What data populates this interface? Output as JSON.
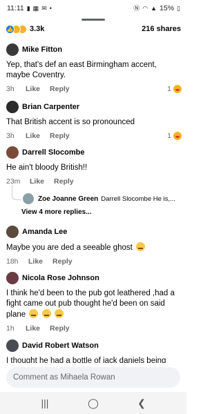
{
  "status_bar": {
    "time": "11:11",
    "battery": "15%"
  },
  "summary": {
    "reaction_count": "3.3k",
    "shares": "216 shares"
  },
  "comments": [
    {
      "name": "Mike Fitton",
      "text": "Yep, that's def an east Birmingham accent, maybe Coventry.",
      "time": "3h",
      "like_label": "Like",
      "reply_label": "Reply",
      "reaction_count": "1",
      "avatar_color": "#3a3a3a"
    },
    {
      "name": "Brian Carpenter",
      "text": "That British accent is so pronounced",
      "time": "3h",
      "like_label": "Like",
      "reply_label": "Reply",
      "reaction_count": "1",
      "avatar_color": "#2b2b2b"
    },
    {
      "name": "Darrell Slocombe",
      "text": "He ain't bloody British!!",
      "time": "23m",
      "like_label": "Like",
      "reply_label": "Reply",
      "avatar_color": "#7a4a3a",
      "reply_preview": {
        "name": "Zoe Joanne Green",
        "snippet": "Darrell Slocombe He is,...",
        "more": "View 4 more replies...",
        "avatar_color": "#8aa0a8"
      }
    },
    {
      "name": "Amanda Lee",
      "text": "Maybe you are ded a seeable ghost",
      "time": "18h",
      "like_label": "Like",
      "reply_label": "Reply",
      "avatar_color": "#5c4a3e"
    },
    {
      "name": "Nicola Rose Johnson",
      "text": "I think he'd been to the pub got leathered ,had a fight came out pub thought he'd been on said plane",
      "time": "1h",
      "like_label": "Like",
      "reply_label": "Reply",
      "avatar_color": "#6b3b44"
    },
    {
      "name": "David Robert Watson",
      "text": "I thought he had a bottle of jack daniels being",
      "avatar_color": "#4a4a52"
    }
  ],
  "composer": {
    "placeholder": "Comment as Mihaela Rowan"
  },
  "icons": {
    "like": "thumbs-up-icon",
    "care": "care-icon",
    "sad": "sad-icon",
    "laugh": "laugh-reaction-icon"
  },
  "colors": {
    "like_blue": "#1877f2",
    "emoji_yellow": "#f7b125",
    "meta_gray": "#65676b"
  }
}
